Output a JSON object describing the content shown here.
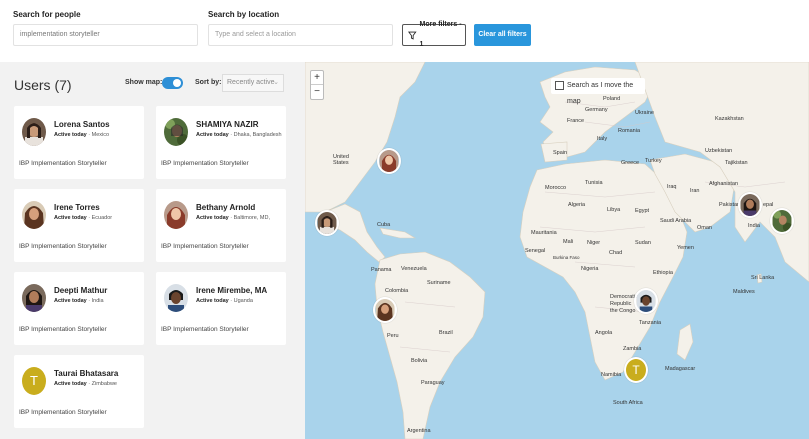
{
  "search": {
    "people_label": "Search for people",
    "people_value": "implementation storyteller",
    "location_label": "Search by location",
    "location_placeholder": "Type and select a location",
    "more_filters": "More filters - 1",
    "clear_filters": "Clear all filters"
  },
  "list": {
    "title": "Users (7)",
    "show_map_label": "Show map:",
    "show_map_on": true,
    "sort_label": "Sort by:",
    "sort_value": "Recently active"
  },
  "users": [
    {
      "name": "Lorena Santos",
      "activity": "Active today",
      "location": "Mexico",
      "role": "IBP Implementation Storyteller",
      "avatar": "photo"
    },
    {
      "name": "SHAMIYA NAZIR",
      "activity": "Active today",
      "location": "Dhaka, Bangladesh",
      "role": "IBP Implementation Storyteller",
      "avatar": "photo"
    },
    {
      "name": "Irene Torres",
      "activity": "Active today",
      "location": "Ecuador",
      "role": "IBP Implementation Storyteller",
      "avatar": "photo"
    },
    {
      "name": "Bethany Arnold",
      "activity": "Active today",
      "location": "Baltimore, MD,",
      "role": "IBP Implementation Storyteller",
      "avatar": "photo"
    },
    {
      "name": "Deepti Mathur",
      "activity": "Active today",
      "location": "India",
      "role": "IBP Implementation Storyteller",
      "avatar": "photo"
    },
    {
      "name": "Irene Mirembe, MA",
      "activity": "Active today",
      "location": "Uganda",
      "role": "IBP Implementation Storyteller",
      "avatar": "photo"
    },
    {
      "name": "Taurai Bhatasara",
      "activity": "Active today",
      "location": "Zimbabwe",
      "role": "IBP Implementation Storyteller",
      "avatar": "T"
    }
  ],
  "map": {
    "zoom_in": "+",
    "zoom_out": "−",
    "search_as_move": "Search as I move the map",
    "marker_initial": "T",
    "labels": {
      "poland": "Poland",
      "germany": "Germany",
      "france": "France",
      "ukraine": "Ukraine",
      "kazakhstan": "Kazakhstan",
      "romania": "Romania",
      "italy": "Italy",
      "spain": "Spain",
      "uzbekistan": "Uzbekistan",
      "greece": "Greece",
      "turkey": "Turkey",
      "tajikistan": "Tajikistan",
      "united_states": "United\nStates",
      "morocco": "Morocco",
      "tunisia": "Tunisia",
      "iraq": "Iraq",
      "iran": "Iran",
      "afghanistan": "Afghanistan",
      "pakistan": "Pakistan",
      "nepal": "epal",
      "algeria": "Algeria",
      "libya": "Libya",
      "egypt": "Egypt",
      "saudi_arabia": "Saudi Arabia",
      "oman": "Oman",
      "india": "India",
      "mauritania": "Mauritania",
      "mali": "Mali",
      "niger": "Niger",
      "sudan": "Sudan",
      "chad": "Chad",
      "yemen": "Yemen",
      "senegal": "Senegal",
      "burkina": "Burkina Faso",
      "nigeria": "Nigeria",
      "ethiopia": "Ethiopia",
      "cuba": "Cuba",
      "venezuela": "Venezuela",
      "panama": "Panama",
      "colombia": "Colombia",
      "suriname": "Suriname",
      "sri_lanka": "Sri Lanka",
      "maldives": "Maldives",
      "drc": "Democratic\nRepublic\nthe Congo",
      "tanzania": "Tanzania",
      "peru": "Peru",
      "brazil": "Brazil",
      "angola": "Angola",
      "zambia": "Zambia",
      "bolivia": "Bolivia",
      "namibia": "Namibia",
      "madagascar": "Madagascar",
      "paraguay": "Paraguay",
      "south_africa": "South Africa",
      "argentina": "Argentina"
    }
  }
}
